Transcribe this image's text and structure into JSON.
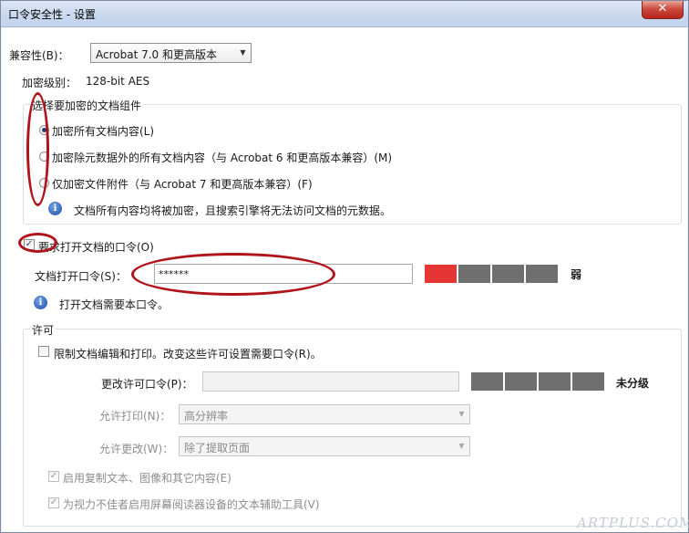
{
  "window": {
    "title": "口令安全性 - 设置",
    "close_glyph": "✕"
  },
  "compatibility": {
    "label": "兼容性(B)：",
    "value": "Acrobat 7.0 和更高版本"
  },
  "encryption_level": {
    "label": "加密级别：",
    "value": "128-bit AES"
  },
  "components_group": {
    "title": "选择要加密的文档组件",
    "options": [
      {
        "label": "加密所有文档内容(L)",
        "selected": true
      },
      {
        "label": "加密除元数据外的所有文档内容（与 Acrobat 6 和更高版本兼容）(M)",
        "selected": false
      },
      {
        "label": "仅加密文件附件（与 Acrobat 7 和更高版本兼容）(F)",
        "selected": false
      }
    ],
    "info_text": "文档所有内容均将被加密，且搜索引擎将无法访问文档的元数据。"
  },
  "open_password": {
    "checkbox_label": "要求打开文档的口令(O)",
    "checked": true,
    "field_label": "文档打开口令(S)：",
    "field_value": "******",
    "strength_label": "弱",
    "strength_level": 1,
    "strength_segments": 4,
    "info_text": "打开文档需要本口令。"
  },
  "permissions": {
    "group_title": "许可",
    "restrict_label": "限制文档编辑和打印。改变这些许可设置需要口令(R)。",
    "restrict_checked": false,
    "change_password_label": "更改许可口令(P)：",
    "change_password_value": "",
    "strength_label": "未分级",
    "strength_level": 0,
    "allow_print_label": "允许打印(N)：",
    "allow_print_value": "高分辨率",
    "allow_change_label": "允许更改(W)：",
    "allow_change_value": "除了提取页面",
    "enable_copy_label": "启用复制文本、图像和其它内容(E)",
    "enable_copy_checked": true,
    "enable_accessibility_label": "为视力不佳者启用屏幕阅读器设备的文本辅助工具(V)",
    "enable_accessibility_checked": true
  },
  "colors": {
    "strength_weak": "#e53535",
    "strength_empty": "#6f6f6f",
    "annotation_red": "#b0141a"
  },
  "watermark": "ARTPLUS.COM"
}
